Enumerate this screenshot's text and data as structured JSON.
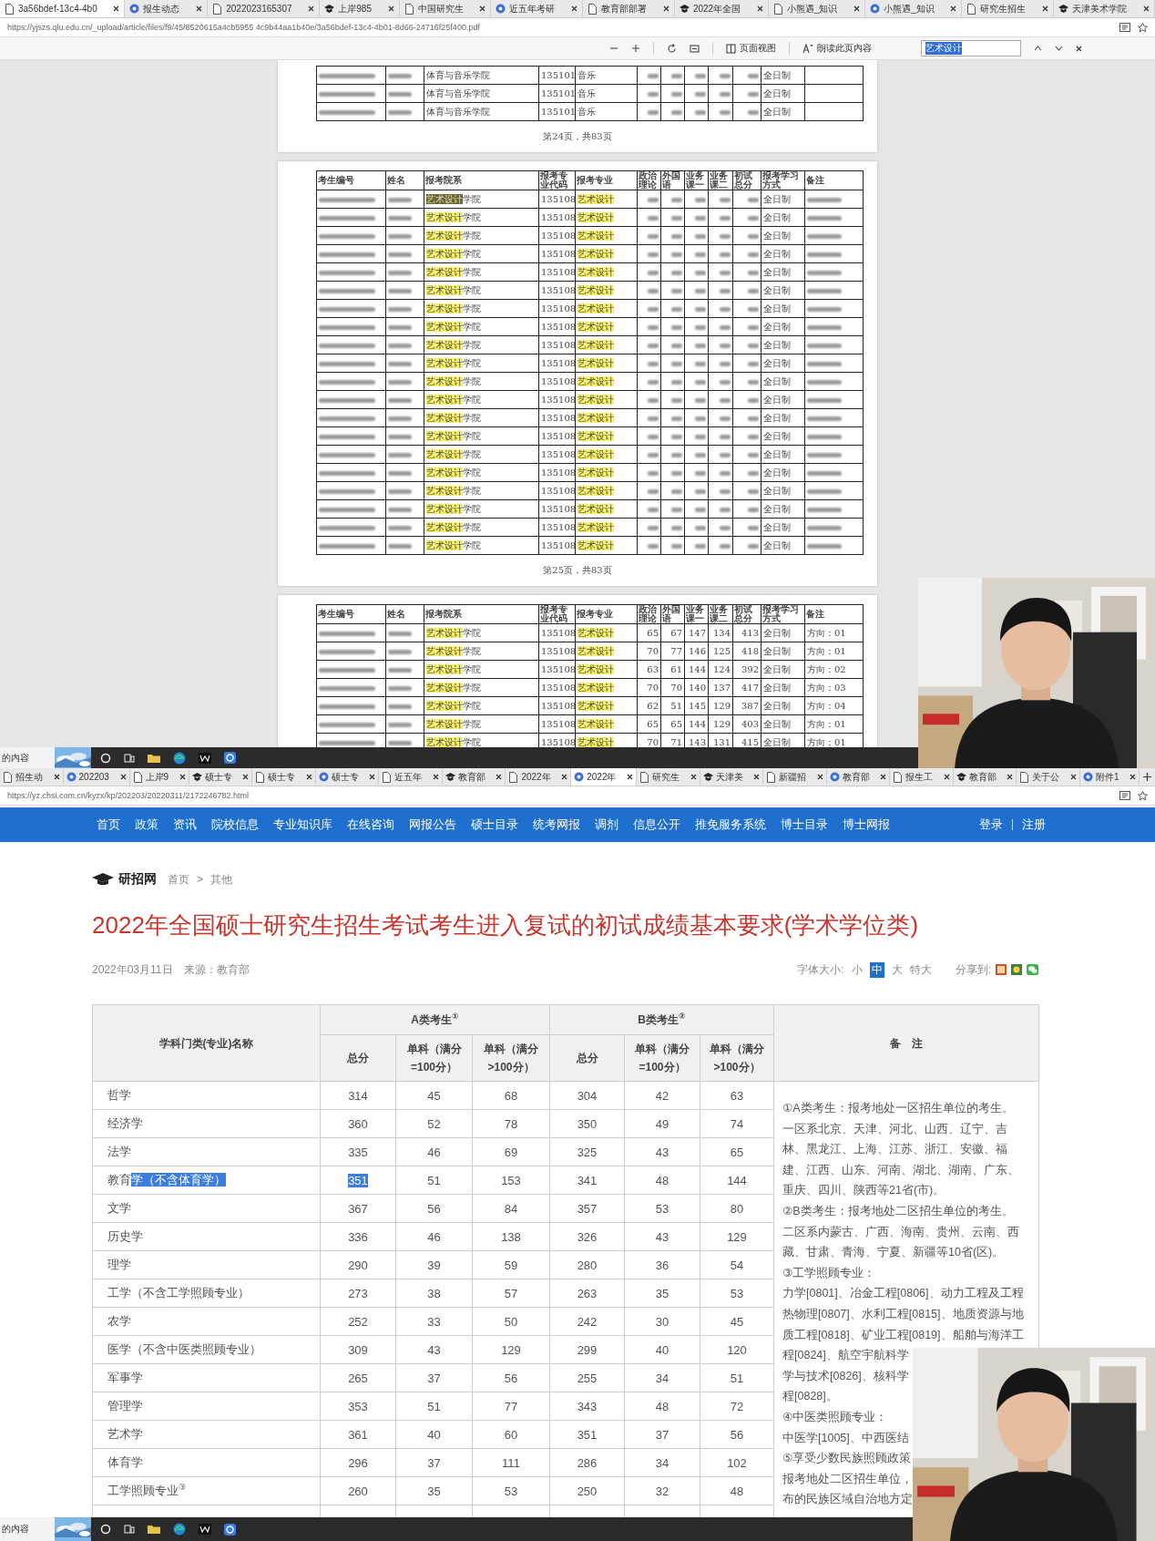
{
  "top_browser": {
    "tabs": [
      {
        "label": "3a56bdef-13c4-4b0",
        "selected": true
      },
      {
        "label": "报生动态",
        "selected": false
      },
      {
        "label": "2022023165307",
        "selected": false
      },
      {
        "label": "上岸985",
        "selected": false
      },
      {
        "label": "中国研究生",
        "selected": false
      },
      {
        "label": "近五年考研",
        "selected": false
      },
      {
        "label": "教育部部署",
        "selected": false
      },
      {
        "label": "2022年全国",
        "selected": false
      },
      {
        "label": "小熊遇_知识",
        "selected": false
      },
      {
        "label": "小熊遇_知识",
        "selected": false
      },
      {
        "label": "研究生招生",
        "selected": false
      },
      {
        "label": "天津美术学院",
        "selected": false
      }
    ],
    "address": "https://yjszs.qlu.edu.cn/_upload/article/files/f9/45/8520615a4cb5955 4c9b44aa1b40e/3a56bdef-13c4-4b01-8d66-24716f25f400.pdf",
    "pdf_toolbar": {
      "page_view": "页面视图",
      "read_aloud": "朗读此页内容",
      "find_value": "艺术设计"
    },
    "pages": [
      {
        "remarks_filled": false,
        "footer": "第24页，共83页",
        "rows": [
          {
            "department": {
              "text": "体育与音乐学院"
            },
            "code": "135101",
            "major": {
              "text": "音乐"
            },
            "mode": "全日制"
          },
          {
            "department": {
              "text": "体育与音乐学院"
            },
            "code": "135101",
            "major": {
              "text": "音乐"
            },
            "mode": "全日制"
          },
          {
            "department": {
              "text": "体育与音乐学院"
            },
            "code": "135101",
            "major": {
              "text": "音乐"
            },
            "mode": "全日制"
          }
        ]
      },
      {
        "columns": [
          "考生编号",
          "姓名",
          "报考院系",
          "报考专业代码",
          "报考专业",
          "政治理论",
          "外国语",
          "业务课一",
          "业务课二",
          "初试总分",
          "报考学习方式",
          "备注"
        ],
        "remarks_filled": true,
        "footer": "第25页，共83页",
        "rows": [
          {
            "department": {
              "marked": "艺术设计",
              "text": "学院",
              "current": true
            },
            "code": "135108",
            "major": {
              "marked": "艺术设计",
              "current": false
            },
            "mode": "全日制"
          },
          {
            "department": {
              "marked": "艺术设计",
              "text": "学院",
              "current": false
            },
            "code": "135108",
            "major": {
              "marked": "艺术设计",
              "current": false
            },
            "mode": "全日制"
          },
          {
            "department": {
              "marked": "艺术设计",
              "text": "学院",
              "current": false
            },
            "code": "135108",
            "major": {
              "marked": "艺术设计",
              "current": false
            },
            "mode": "全日制"
          },
          {
            "department": {
              "marked": "艺术设计",
              "text": "学院",
              "current": false
            },
            "code": "135108",
            "major": {
              "marked": "艺术设计",
              "current": false
            },
            "mode": "全日制"
          },
          {
            "department": {
              "marked": "艺术设计",
              "text": "学院",
              "current": false
            },
            "code": "135108",
            "major": {
              "marked": "艺术设计",
              "current": false
            },
            "mode": "全日制"
          },
          {
            "department": {
              "marked": "艺术设计",
              "text": "学院",
              "current": false
            },
            "code": "135108",
            "major": {
              "marked": "艺术设计",
              "current": false
            },
            "mode": "全日制"
          },
          {
            "department": {
              "marked": "艺术设计",
              "text": "学院",
              "current": false
            },
            "code": "135108",
            "major": {
              "marked": "艺术设计",
              "current": false
            },
            "mode": "全日制"
          },
          {
            "department": {
              "marked": "艺术设计",
              "text": "学院",
              "current": false
            },
            "code": "135108",
            "major": {
              "marked": "艺术设计",
              "current": false
            },
            "mode": "全日制"
          },
          {
            "department": {
              "marked": "艺术设计",
              "text": "学院",
              "current": false
            },
            "code": "135108",
            "major": {
              "marked": "艺术设计",
              "current": false
            },
            "mode": "全日制"
          },
          {
            "department": {
              "marked": "艺术设计",
              "text": "学院",
              "current": false
            },
            "code": "135108",
            "major": {
              "marked": "艺术设计",
              "current": false
            },
            "mode": "全日制"
          },
          {
            "department": {
              "marked": "艺术设计",
              "text": "学院",
              "current": false
            },
            "code": "135108",
            "major": {
              "marked": "艺术设计",
              "current": false
            },
            "mode": "全日制"
          },
          {
            "department": {
              "marked": "艺术设计",
              "text": "学院",
              "current": false
            },
            "code": "135108",
            "major": {
              "marked": "艺术设计",
              "current": false
            },
            "mode": "全日制"
          },
          {
            "department": {
              "marked": "艺术设计",
              "text": "学院",
              "current": false
            },
            "code": "135108",
            "major": {
              "marked": "艺术设计",
              "current": false
            },
            "mode": "全日制"
          },
          {
            "department": {
              "marked": "艺术设计",
              "text": "学院",
              "current": false
            },
            "code": "135108",
            "major": {
              "marked": "艺术设计",
              "current": false
            },
            "mode": "全日制"
          },
          {
            "department": {
              "marked": "艺术设计",
              "text": "学院",
              "current": false
            },
            "code": "135108",
            "major": {
              "marked": "艺术设计",
              "current": false
            },
            "mode": "全日制"
          },
          {
            "department": {
              "marked": "艺术设计",
              "text": "学院",
              "current": false
            },
            "code": "135108",
            "major": {
              "marked": "艺术设计",
              "current": false
            },
            "mode": "全日制"
          },
          {
            "department": {
              "marked": "艺术设计",
              "text": "学院",
              "current": false
            },
            "code": "135108",
            "major": {
              "marked": "艺术设计",
              "current": false
            },
            "mode": "全日制"
          },
          {
            "department": {
              "marked": "艺术设计",
              "text": "学院",
              "current": false
            },
            "code": "135108",
            "major": {
              "marked": "艺术设计",
              "current": false
            },
            "mode": "全日制"
          },
          {
            "department": {
              "marked": "艺术设计",
              "text": "学院",
              "current": false
            },
            "code": "135108",
            "major": {
              "marked": "艺术设计",
              "current": false
            },
            "mode": "全日制"
          },
          {
            "department": {
              "marked": "艺术设计",
              "text": "学院",
              "current": false
            },
            "code": "135108",
            "major": {
              "marked": "艺术设计",
              "current": false
            },
            "mode": "全日制"
          }
        ]
      },
      {
        "columns": [
          "考生编号",
          "姓名",
          "报考院系",
          "报考专业代码",
          "报考专业",
          "政治理论",
          "外国语",
          "业务课一",
          "业务课二",
          "初试总分",
          "报考学习方式",
          "备注"
        ],
        "rows": [
          {
            "department": {
              "marked": "艺术设计",
              "text": "学院",
              "current": false
            },
            "code": "135108",
            "major": {
              "marked": "艺术设计",
              "current": false
            },
            "scores": [
              "65",
              "67",
              "147",
              "134",
              "413"
            ],
            "mode": "全日制",
            "remark": "方向：01"
          },
          {
            "department": {
              "marked": "艺术设计",
              "text": "学院",
              "current": false
            },
            "code": "135108",
            "major": {
              "marked": "艺术设计",
              "current": false
            },
            "scores": [
              "70",
              "77",
              "146",
              "125",
              "418"
            ],
            "mode": "全日制",
            "remark": "方向：01"
          },
          {
            "department": {
              "marked": "艺术设计",
              "text": "学院",
              "current": false
            },
            "code": "135108",
            "major": {
              "marked": "艺术设计",
              "current": false
            },
            "scores": [
              "63",
              "61",
              "144",
              "124",
              "392"
            ],
            "mode": "全日制",
            "remark": "方向：02"
          },
          {
            "department": {
              "marked": "艺术设计",
              "text": "学院",
              "current": false
            },
            "code": "135108",
            "major": {
              "marked": "艺术设计",
              "current": false
            },
            "scores": [
              "70",
              "70",
              "140",
              "137",
              "417"
            ],
            "mode": "全日制",
            "remark": "方向：03"
          },
          {
            "department": {
              "marked": "艺术设计",
              "text": "学院",
              "current": false
            },
            "code": "135108",
            "major": {
              "marked": "艺术设计",
              "current": false
            },
            "scores": [
              "62",
              "51",
              "145",
              "129",
              "387"
            ],
            "mode": "全日制",
            "remark": "方向：04"
          },
          {
            "department": {
              "marked": "艺术设计",
              "text": "学院",
              "current": false
            },
            "code": "135108",
            "major": {
              "marked": "艺术设计",
              "current": false
            },
            "scores": [
              "65",
              "65",
              "144",
              "129",
              "403"
            ],
            "mode": "全日制",
            "remark": "方向：01"
          },
          {
            "department": {
              "marked": "艺术设计",
              "text": "学院",
              "current": false
            },
            "code": "135108",
            "major": {
              "marked": "艺术设计",
              "current": false
            },
            "scores": [
              "70",
              "71",
              "143",
              "131",
              "415"
            ],
            "mode": "全日制",
            "remark": "方向：01"
          }
        ]
      }
    ]
  },
  "taskbars": {
    "top": {
      "label": "的内容"
    },
    "bottom": {
      "label": "的内容"
    }
  },
  "bottom_browser": {
    "tabs": [
      {
        "label": "招生动",
        "selected": false
      },
      {
        "label": "202203",
        "selected": false
      },
      {
        "label": "上岸9",
        "selected": false
      },
      {
        "label": "硕士专",
        "selected": false
      },
      {
        "label": "硕士专",
        "selected": false
      },
      {
        "label": "硕士专",
        "selected": false
      },
      {
        "label": "近五年",
        "selected": false
      },
      {
        "label": "教育部",
        "selected": false
      },
      {
        "label": "2022年",
        "selected": false
      },
      {
        "label": "2022年",
        "selected": true
      },
      {
        "label": "研究生",
        "selected": false
      },
      {
        "label": "天津美",
        "selected": false
      },
      {
        "label": "新疆招",
        "selected": false
      },
      {
        "label": "教育部",
        "selected": false
      },
      {
        "label": "报生工",
        "selected": false
      },
      {
        "label": "教育部",
        "selected": false
      },
      {
        "label": "关于公",
        "selected": false
      },
      {
        "label": "附件1",
        "selected": false
      }
    ],
    "address": "https://yz.chsi.com.cn/kyzx/kp/202203/20220311/2172246782.html"
  },
  "site": {
    "nav": [
      "首页",
      "政策",
      "资讯",
      "院校信息",
      "专业知识库",
      "在线咨询",
      "网报公告",
      "硕士目录",
      "统考网报",
      "调剂",
      "信息公开",
      "推免服务系统",
      "博士目录",
      "博士网报"
    ],
    "account": [
      "登录",
      "注册"
    ],
    "logo": "研招网",
    "breadcrumb": [
      "首页",
      "其他"
    ],
    "breadcrumb_separator": ">",
    "title": "2022年全国硕士研究生招生考试考生进入复试的初试成绩基本要求(学术学位类)",
    "date": "2022年03月11日",
    "source": "来源：教育部",
    "font_size_label": "字体大小:",
    "font_sizes": [
      {
        "label": "小",
        "selected": false
      },
      {
        "label": "中",
        "selected": true
      },
      {
        "label": "大",
        "selected": false
      },
      {
        "label": "特大",
        "selected": false
      }
    ],
    "share_label": "分享到:",
    "table": {
      "subject_header": "学科门类(专业)名称",
      "group_a": "A类考生$^{①}$",
      "group_b": "B类考生$^{②}$",
      "note_header": "备　注",
      "sub_headers": [
        "总分",
        "单科（满分=100分）",
        "单科（满分>100分）",
        "总分",
        "单科（满分=100分）",
        "单科（满分>100分）"
      ],
      "rows": [
        {
          "subject": [
            {
              "text": "哲学",
              "selected": false
            }
          ],
          "values": [
            {
              "text": "314",
              "selected": false
            },
            {
              "text": "45",
              "selected": false
            },
            {
              "text": "68",
              "selected": false
            },
            {
              "text": "304",
              "selected": false
            },
            {
              "text": "42",
              "selected": false
            },
            {
              "text": "63",
              "selected": false
            }
          ]
        },
        {
          "subject": [
            {
              "text": "经济学",
              "selected": false
            }
          ],
          "values": [
            {
              "text": "360",
              "selected": false
            },
            {
              "text": "52",
              "selected": false
            },
            {
              "text": "78",
              "selected": false
            },
            {
              "text": "350",
              "selected": false
            },
            {
              "text": "49",
              "selected": false
            },
            {
              "text": "74",
              "selected": false
            }
          ]
        },
        {
          "subject": [
            {
              "text": "法学",
              "selected": false
            }
          ],
          "values": [
            {
              "text": "335",
              "selected": false
            },
            {
              "text": "46",
              "selected": false
            },
            {
              "text": "69",
              "selected": false
            },
            {
              "text": "325",
              "selected": false
            },
            {
              "text": "43",
              "selected": false
            },
            {
              "text": "65",
              "selected": false
            }
          ]
        },
        {
          "subject": [
            {
              "text": "教育",
              "selected": false
            },
            {
              "text": "学（不含体育学）",
              "selected": true
            }
          ],
          "values": [
            {
              "text": "351",
              "selected": true
            },
            {
              "text": "51",
              "selected": false
            },
            {
              "text": "153",
              "selected": false
            },
            {
              "text": "341",
              "selected": false
            },
            {
              "text": "48",
              "selected": false
            },
            {
              "text": "144",
              "selected": false
            }
          ]
        },
        {
          "subject": [
            {
              "text": "文学",
              "selected": false
            }
          ],
          "values": [
            {
              "text": "367",
              "selected": false
            },
            {
              "text": "56",
              "selected": false
            },
            {
              "text": "84",
              "selected": false
            },
            {
              "text": "357",
              "selected": false
            },
            {
              "text": "53",
              "selected": false
            },
            {
              "text": "80",
              "selected": false
            }
          ]
        },
        {
          "subject": [
            {
              "text": "历史学",
              "selected": false
            }
          ],
          "values": [
            {
              "text": "336",
              "selected": false
            },
            {
              "text": "46",
              "selected": false
            },
            {
              "text": "138",
              "selected": false
            },
            {
              "text": "326",
              "selected": false
            },
            {
              "text": "43",
              "selected": false
            },
            {
              "text": "129",
              "selected": false
            }
          ]
        },
        {
          "subject": [
            {
              "text": "理学",
              "selected": false
            }
          ],
          "values": [
            {
              "text": "290",
              "selected": false
            },
            {
              "text": "39",
              "selected": false
            },
            {
              "text": "59",
              "selected": false
            },
            {
              "text": "280",
              "selected": false
            },
            {
              "text": "36",
              "selected": false
            },
            {
              "text": "54",
              "selected": false
            }
          ]
        },
        {
          "subject": [
            {
              "text": "工学（不含工学照顾专业）",
              "selected": false
            }
          ],
          "values": [
            {
              "text": "273",
              "selected": false
            },
            {
              "text": "38",
              "selected": false
            },
            {
              "text": "57",
              "selected": false
            },
            {
              "text": "263",
              "selected": false
            },
            {
              "text": "35",
              "selected": false
            },
            {
              "text": "53",
              "selected": false
            }
          ]
        },
        {
          "subject": [
            {
              "text": "农学",
              "selected": false
            }
          ],
          "values": [
            {
              "text": "252",
              "selected": false
            },
            {
              "text": "33",
              "selected": false
            },
            {
              "text": "50",
              "selected": false
            },
            {
              "text": "242",
              "selected": false
            },
            {
              "text": "30",
              "selected": false
            },
            {
              "text": "45",
              "selected": false
            }
          ]
        },
        {
          "subject": [
            {
              "text": "医学（不含中医类照顾专业）",
              "selected": false
            }
          ],
          "values": [
            {
              "text": "309",
              "selected": false
            },
            {
              "text": "43",
              "selected": false
            },
            {
              "text": "129",
              "selected": false
            },
            {
              "text": "299",
              "selected": false
            },
            {
              "text": "40",
              "selected": false
            },
            {
              "text": "120",
              "selected": false
            }
          ]
        },
        {
          "subject": [
            {
              "text": "军事学",
              "selected": false
            }
          ],
          "values": [
            {
              "text": "265",
              "selected": false
            },
            {
              "text": "37",
              "selected": false
            },
            {
              "text": "56",
              "selected": false
            },
            {
              "text": "255",
              "selected": false
            },
            {
              "text": "34",
              "selected": false
            },
            {
              "text": "51",
              "selected": false
            }
          ]
        },
        {
          "subject": [
            {
              "text": "管理学",
              "selected": false
            }
          ],
          "values": [
            {
              "text": "353",
              "selected": false
            },
            {
              "text": "51",
              "selected": false
            },
            {
              "text": "77",
              "selected": false
            },
            {
              "text": "343",
              "selected": false
            },
            {
              "text": "48",
              "selected": false
            },
            {
              "text": "72",
              "selected": false
            }
          ]
        },
        {
          "subject": [
            {
              "text": "艺术学",
              "selected": false
            }
          ],
          "values": [
            {
              "text": "361",
              "selected": false
            },
            {
              "text": "40",
              "selected": false
            },
            {
              "text": "60",
              "selected": false
            },
            {
              "text": "351",
              "selected": false
            },
            {
              "text": "37",
              "selected": false
            },
            {
              "text": "56",
              "selected": false
            }
          ]
        },
        {
          "subject": [
            {
              "text": "体育学",
              "selected": false
            }
          ],
          "values": [
            {
              "text": "296",
              "selected": false
            },
            {
              "text": "37",
              "selected": false
            },
            {
              "text": "111",
              "selected": false
            },
            {
              "text": "286",
              "selected": false
            },
            {
              "text": "34",
              "selected": false
            },
            {
              "text": "102",
              "selected": false
            }
          ]
        },
        {
          "subject": [
            {
              "text": "工学照顾专业$^{③}$",
              "selected": false
            }
          ],
          "values": [
            {
              "text": "260",
              "selected": false
            },
            {
              "text": "35",
              "selected": false
            },
            {
              "text": "53",
              "selected": false
            },
            {
              "text": "250",
              "selected": false
            },
            {
              "text": "32",
              "selected": false
            },
            {
              "text": "48",
              "selected": false
            }
          ]
        }
      ],
      "note_lines": [
        "①A类考生：报考地处一区招生单位的考生。",
        "一区系北京、天津、河北、山西、辽宁、吉",
        "林、黑龙江、上海、江苏、浙江、安徽、福",
        "建、江西、山东、河南、湖北、湖南、广东、",
        "重庆、四川、陕西等21省(市)。",
        "②B类考生：报考地处二区招生单位的考生。",
        "二区系内蒙古、广西、海南、贵州、云南、西",
        "藏、甘肃、青海、宁夏、新疆等10省(区)。",
        "③工学照顾专业：",
        "力学[0801]、冶金工程[0806]、动力工程及工程",
        "热物理[0807]、水利工程[0815]、地质资源与地",
        "质工程[0818]、矿业工程[0819]、船舶与海洋工",
        "程[0824]、航空宇航科学",
        "学与技术[0826]、核科学",
        "程[0828]。",
        "④中医类照顾专业：",
        "中医学[1005]、中西医结",
        "⑤享受少数民族照顾政策",
        "报考地处二区招生单位，",
        "布的民族区域自治地方定"
      ]
    }
  }
}
